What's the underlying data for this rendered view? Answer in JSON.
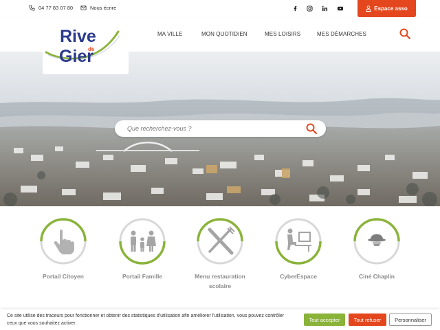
{
  "topbar": {
    "phone": "04 77 83 07 80",
    "write": "Nous écrire",
    "social": [
      "facebook-icon",
      "instagram-icon",
      "linkedin-icon",
      "youtube-icon"
    ],
    "espace_asso": "Espace asso"
  },
  "logo": {
    "line1": "Rive",
    "de": "de",
    "line2": "Gier"
  },
  "nav": {
    "items": [
      "MA VILLE",
      "MON QUOTIDIEN",
      "MES LOISIRS",
      "MES DÉMARCHES"
    ]
  },
  "search": {
    "placeholder": "Que recherchez-vous ?"
  },
  "quick_links": [
    {
      "label_line1": "Portail Citoyen",
      "label_line2": "",
      "icon": "hand-pointer-icon"
    },
    {
      "label_line1": "Portail Famille",
      "label_line2": "",
      "icon": "family-icon"
    },
    {
      "label_line1": "Menu restauration",
      "label_line2": "scolaire",
      "icon": "cutlery-icon"
    },
    {
      "label_line1": "CyberEspace",
      "label_line2": "",
      "icon": "computer-user-icon"
    },
    {
      "label_line1": "Ciné Chaplin",
      "label_line2": "",
      "icon": "bowler-hat-icon"
    }
  ],
  "cookie": {
    "text": "Ce site utilise des traceurs pour fonctionner et obtenir des statistiques d'utilisation afin améliorer l'utilisation, vous pouvez contrôler ceux que vous souhaitez activer.",
    "accept": "Tout accepter",
    "refuse": "Tout refuser",
    "customize": "Personnaliser"
  },
  "colors": {
    "accent_orange": "#e4471d",
    "accent_green": "#8ab33a",
    "logo_blue": "#2b3a8c"
  }
}
